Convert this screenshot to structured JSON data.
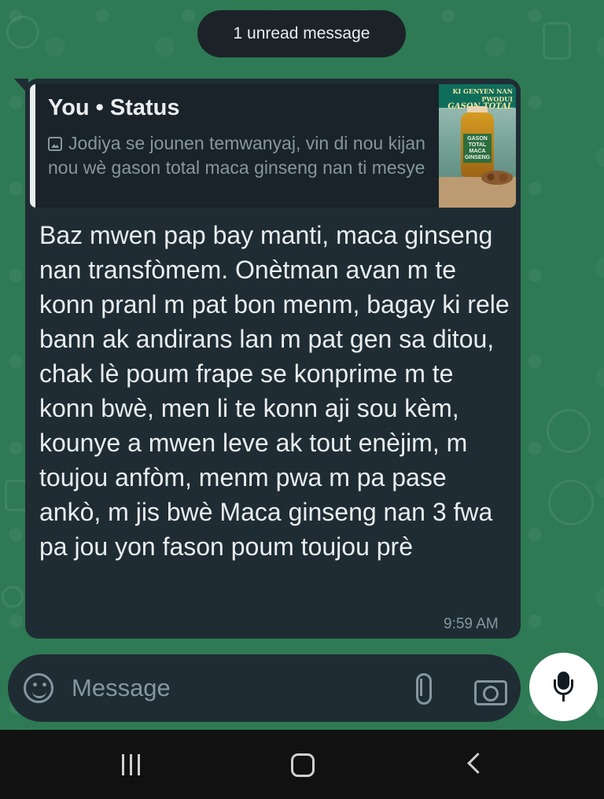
{
  "banner": {
    "unread_label": "1 unread message"
  },
  "quoted_status": {
    "author": "You • Status",
    "preview": "Jodiya se jounen temwanyaj, vin di nou kijan nou wè gason total maca ginseng nan ti mesye",
    "thumbnail_text": {
      "banner": "KI GENYEN NAN PWODUI",
      "title": "GASON TOTAL",
      "bottle_label": "GASON TOTAL MACA GINSENG"
    },
    "icon": "image-icon"
  },
  "message": {
    "text": "Baz mwen pap bay manti, maca ginseng nan transfòmem. Onètman avan m te konn pranl m pat bon menm, bagay ki rele bann ak andirans lan m pat gen sa ditou, chak lè poum frape se konprime m te konn bwè, men li te konn aji sou kèm, kounye a mwen leve ak tout enèjim, m toujou anfòm, menm pwa m pa pase ankò, m jis bwè Maca ginseng nan 3 fwa pa jou yon fason poum toujou prè",
    "time": "9:59 AM"
  },
  "composer": {
    "placeholder": "Message",
    "icons": {
      "emoji": "emoji-icon",
      "attach": "paperclip-icon",
      "camera": "camera-icon",
      "mic": "microphone-icon"
    }
  },
  "system_nav": {
    "icons": [
      "recent-apps-icon",
      "home-icon",
      "back-icon"
    ]
  },
  "colors": {
    "wallpaper": "#2e7a54",
    "bubble": "#1f2c34",
    "primary_text": "#e9edef",
    "secondary_text": "#8696a0",
    "mic_button": "#ffffff"
  }
}
